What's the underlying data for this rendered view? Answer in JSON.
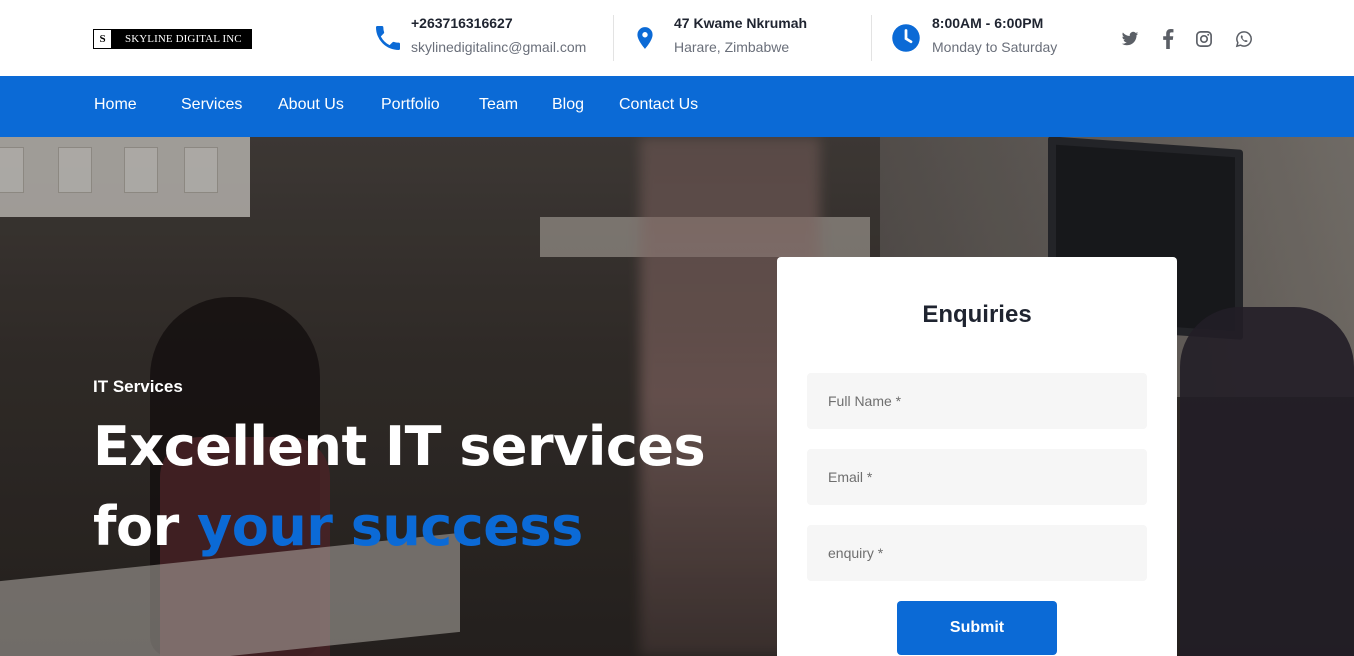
{
  "brand": {
    "logo_mark": "S",
    "logo_text": "SKYLINE DIGITAL INC"
  },
  "contact": {
    "phone": {
      "icon": "phone-icon",
      "line1": "+263716316627",
      "line2": "skylinedigitalinc@gmail.com"
    },
    "address": {
      "icon": "location-pin-icon",
      "line1": "47 Kwame Nkrumah",
      "line2": "Harare, Zimbabwe"
    },
    "hours": {
      "icon": "clock-icon",
      "line1": "8:00AM - 6:00PM",
      "line2": "Monday to Saturday"
    }
  },
  "social": [
    "twitter-icon",
    "facebook-icon",
    "instagram-icon",
    "whatsapp-icon"
  ],
  "nav": {
    "items": [
      "Home",
      "Services",
      "About Us",
      "Portfolio",
      "Team",
      "Blog",
      "Contact Us"
    ]
  },
  "hero": {
    "kicker": "IT Services",
    "line1": "Excellent IT services",
    "line2_prefix": "for ",
    "line2_accent": "your success"
  },
  "enquiry": {
    "title": "Enquiries",
    "name_placeholder": "Full Name *",
    "email_placeholder": "Email *",
    "enquiry_placeholder": "enquiry *",
    "submit_label": "Submit"
  },
  "colors": {
    "accent": "#0b6ad6",
    "heading": "#1f2430",
    "muted": "#6a6f7a"
  }
}
